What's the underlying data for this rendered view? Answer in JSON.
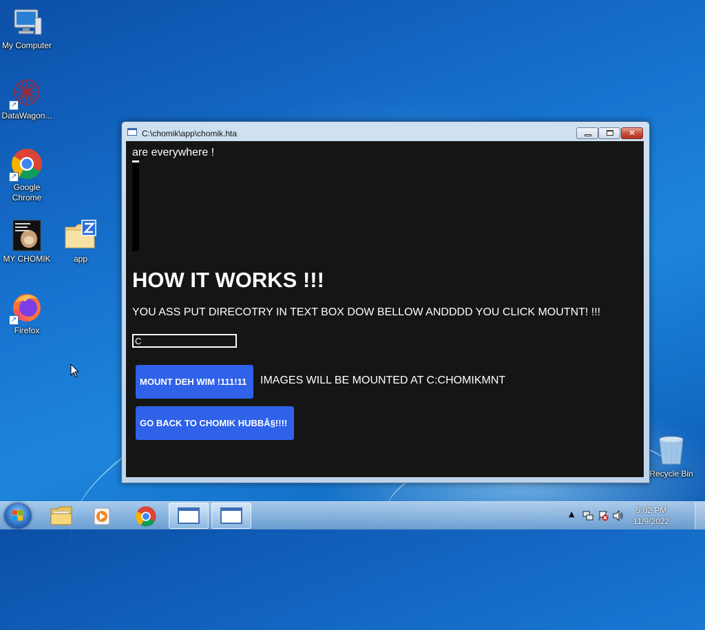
{
  "desktop": {
    "icons": [
      {
        "label": "My Computer",
        "icon": "computer-icon"
      },
      {
        "label": "DataWagon...",
        "icon": "datawagon-icon"
      },
      {
        "label": "Google Chrome",
        "icon": "chrome-icon"
      },
      {
        "label": "MY CHOMIK",
        "icon": "image-icon"
      },
      {
        "label": "app",
        "icon": "zipped-folder-icon"
      },
      {
        "label": "Firefox",
        "icon": "firefox-icon"
      },
      {
        "label": "Recycle Bin",
        "icon": "recycle-bin-icon"
      }
    ]
  },
  "window": {
    "title": "C:\\chomik\\app\\chomik.hta",
    "scroll_text": "are everywhere !",
    "heading": "HOW IT WORKS !!!",
    "instructions": "YOU ASS PUT DIRECOTRY IN TEXT BOX DOW BELLOW ANDDDD YOU CLICK MOUTNT! !!!",
    "directory_value": "C",
    "mount_button": "MOUNT DEH WIM !111!11",
    "mount_note": "IMAGES WILL BE MOUNTED AT C:CHOMIKMNT",
    "back_button": "GO BACK TO CHOMIK HUBBÂ§!!!!"
  },
  "taskbar": {
    "pinned": [
      "folder-icon",
      "media-player-icon",
      "chrome-icon",
      "window-icon",
      "window-icon"
    ],
    "clock_time": "5:02 PM",
    "clock_date": "11/9/2022",
    "tray": [
      "chevron-up-icon",
      "network-icon",
      "action-center-icon",
      "volume-icon"
    ]
  },
  "colors": {
    "accent_button": "#2f62e8",
    "app_background": "#151515",
    "desktop_blue": "#1773cf"
  }
}
